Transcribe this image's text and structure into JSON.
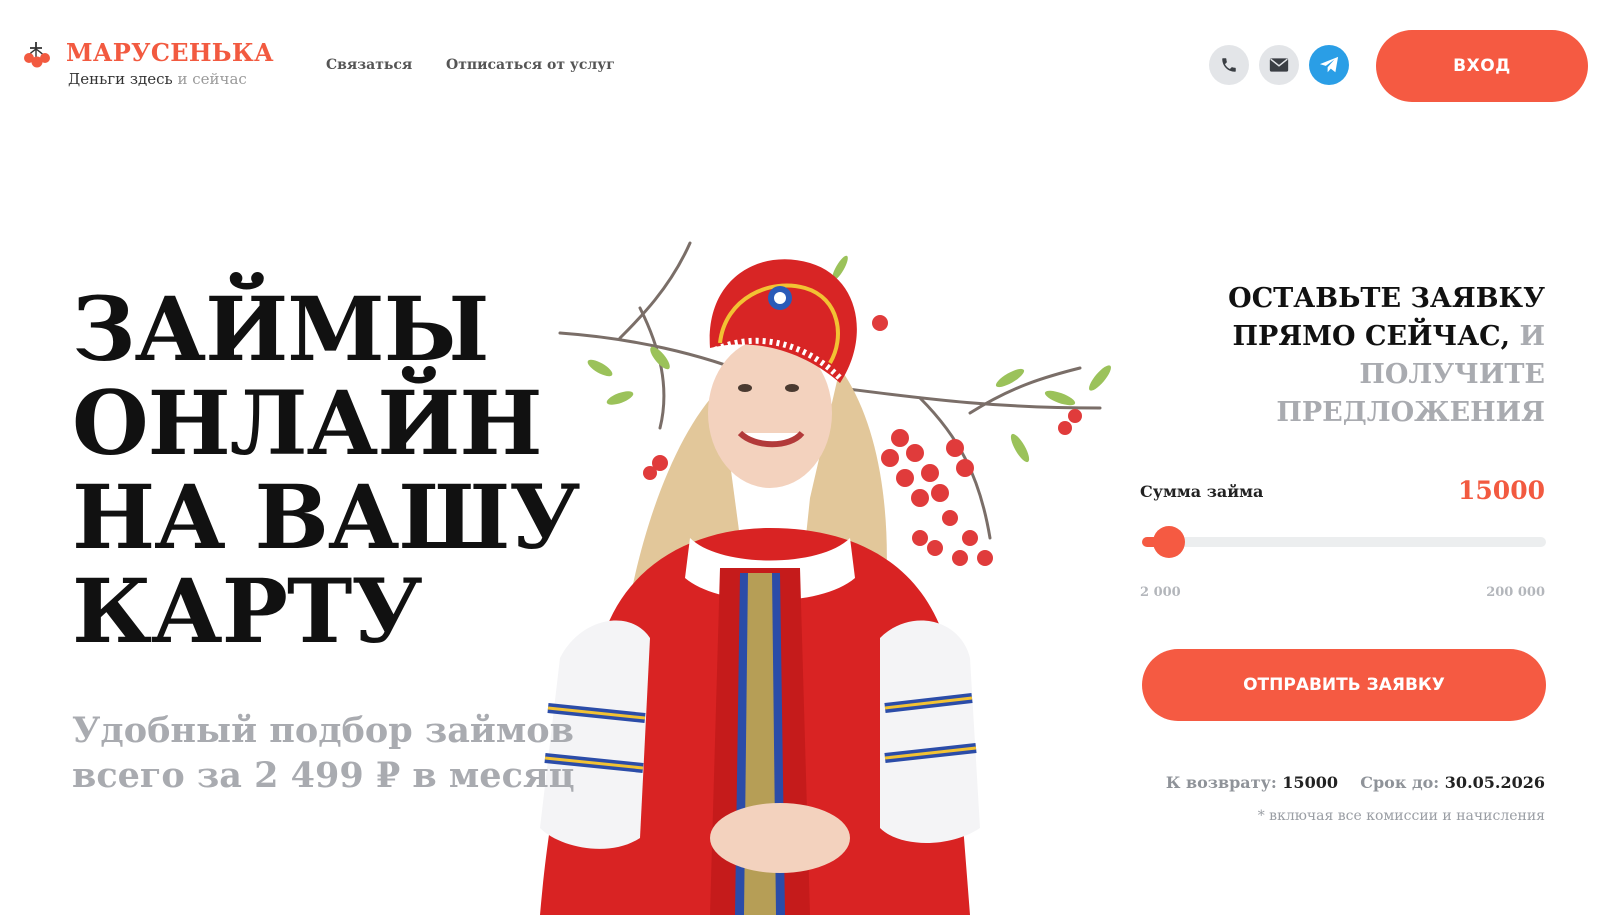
{
  "header": {
    "brand": "МАРУСЕНЬКА",
    "tagline_main": "Деньги здесь",
    "tagline_muted": "и сейчас",
    "nav": [
      {
        "label": "Связаться"
      },
      {
        "label": "Отписаться от услуг"
      }
    ],
    "contact_icons": [
      "phone-icon",
      "mail-icon",
      "telegram-icon"
    ],
    "login_label": "ВХОД"
  },
  "hero": {
    "title_lines": [
      "ЗАЙМЫ",
      "ОНЛАЙН",
      "НА ВАШУ",
      "КАРТУ"
    ],
    "subtitle_lines": [
      "Удобный подбор займов",
      "всего за 2 499 ₽ в месяц"
    ]
  },
  "form": {
    "title_dark_1": "ОСТАВЬТЕ ЗАЯВКУ",
    "title_dark_2": "ПРЯМО СЕЙЧАС,",
    "title_grey_1": "И",
    "title_grey_2": "ПОЛУЧИТЕ",
    "title_grey_3": "ПРЕДЛОЖЕНИЯ",
    "sum_label": "Сумма займа",
    "sum_value": "15000",
    "range_min": "2 000",
    "range_max": "200 000",
    "slider_fraction": 0.066,
    "submit_label": "ОТПРАВИТЬ ЗАЯВКУ",
    "return_label": "К возврату:",
    "return_value": "15000",
    "term_label": "Срок до:",
    "term_value": "30.05.2026",
    "note": "* включая все комиссии и начисления"
  },
  "colors": {
    "accent": "#f55a42",
    "grey_text": "#a9abb0",
    "telegram": "#2a9ee6"
  }
}
